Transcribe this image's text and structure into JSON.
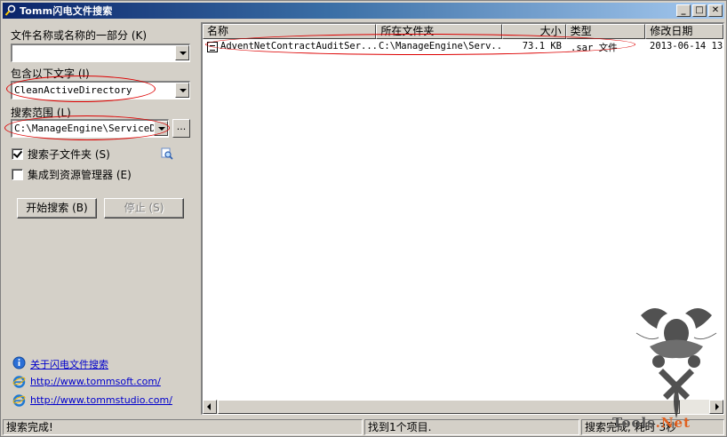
{
  "window": {
    "title": "Tomm闪电文件搜索",
    "minimize": "_",
    "maximize": "□",
    "close": "✕"
  },
  "form": {
    "filename_label": "文件名称或名称的一部分 (K)",
    "filename_value": "",
    "contains_label": "包含以下文字 (I)",
    "contains_value": "CleanActiveDirectory",
    "scope_label": "搜索范围 (L)",
    "scope_value": "C:\\ManageEngine\\ServiceDes",
    "browse_label": "...",
    "subfolders_label": "搜索子文件夹 (S)",
    "subfolders_checked": true,
    "integrate_label": "集成到资源管理器 (E)",
    "integrate_checked": false,
    "start_button": "开始搜索 (B)",
    "stop_button": "停止 (S)"
  },
  "links": [
    {
      "text": "关于闪电文件搜索",
      "icon": "info-icon"
    },
    {
      "text": "http://www.tommsoft.com/",
      "icon": "ie-icon"
    },
    {
      "text": "http://www.tommstudio.com/",
      "icon": "ie-icon"
    }
  ],
  "list": {
    "columns": [
      "名称",
      "所在文件夹",
      "大小",
      "类型",
      "修改日期"
    ],
    "rows": [
      {
        "name": "AdventNetContractAuditSer...",
        "folder": "C:\\ManageEngine\\Serv...",
        "size": "73.1 KB",
        "type": ".sar 文件",
        "modified": "2013-06-14 13"
      }
    ]
  },
  "status": {
    "left": "搜索完成!",
    "middle": "找到1个项目.",
    "right": "搜索完成, 耗时 3秒"
  },
  "watermark": {
    "text_main": "Tools",
    "text_accent": ".Net"
  },
  "colors": {
    "annotation": "#dd0000",
    "link": "#0000cc",
    "titlebar": "#0a246a"
  }
}
